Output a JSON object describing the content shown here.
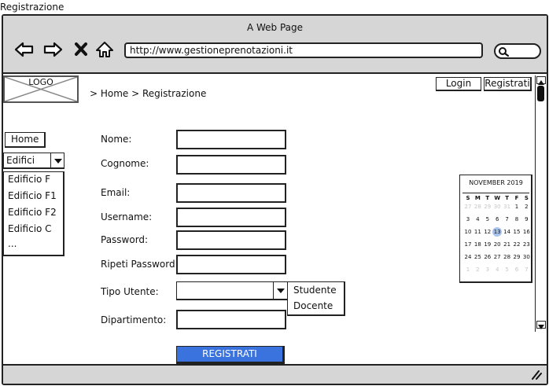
{
  "page_title": "Registrazione",
  "window": {
    "title": "A Web Page",
    "url": "http://www.gestioneprenotazioni.it"
  },
  "icons": {
    "back": "arrow-left-icon",
    "forward": "arrow-right-icon",
    "stop": "x-icon",
    "home": "home-icon",
    "search": "search-icon",
    "resize": "resize-grip-icon"
  },
  "logo": "LOGO",
  "breadcrumb": "> Home > Registrazione",
  "header": {
    "login_label": "Login",
    "register_label": "Registrati"
  },
  "sidebar": {
    "home_label": "Home",
    "dropdown_value": "Edifici",
    "items": [
      "Edificio F",
      "Edificio F1",
      "Edificio F2",
      "Edificio C",
      "..."
    ]
  },
  "form": {
    "fields": [
      "Nome:",
      "Cognome:",
      "Email:",
      "Username:",
      "Password:",
      "Ripeti Password:"
    ],
    "user_type_label": "Tipo Utente:",
    "user_type_options": [
      "Studente",
      "Docente"
    ],
    "department_label": "Dipartimento:",
    "submit_label": "REGISTRATI"
  },
  "calendar": {
    "month": "NOVEMBER 2019",
    "weekdays": [
      "S",
      "M",
      "T",
      "W",
      "T",
      "F",
      "S"
    ],
    "weeks": [
      [
        "27",
        "28",
        "29",
        "30",
        "31",
        "1",
        "2"
      ],
      [
        "3",
        "4",
        "5",
        "6",
        "7",
        "8",
        "9"
      ],
      [
        "10",
        "11",
        "12",
        "13",
        "14",
        "15",
        "16"
      ],
      [
        "17",
        "18",
        "19",
        "20",
        "21",
        "22",
        "23"
      ],
      [
        "24",
        "25",
        "26",
        "27",
        "28",
        "29",
        "30"
      ],
      [
        "1",
        "2",
        "3",
        "4",
        "5",
        "6",
        "7"
      ]
    ],
    "muted": [
      [
        0,
        0
      ],
      [
        0,
        1
      ],
      [
        0,
        2
      ],
      [
        0,
        3
      ],
      [
        0,
        4
      ],
      [
        5,
        0
      ],
      [
        5,
        1
      ],
      [
        5,
        2
      ],
      [
        5,
        3
      ],
      [
        5,
        4
      ],
      [
        5,
        5
      ],
      [
        5,
        6
      ]
    ],
    "selected_day": "13"
  },
  "colors": {
    "primary_button": "#3a73de",
    "chrome": "#d6d6d6",
    "calendar_selected": "#a9c3ea"
  }
}
